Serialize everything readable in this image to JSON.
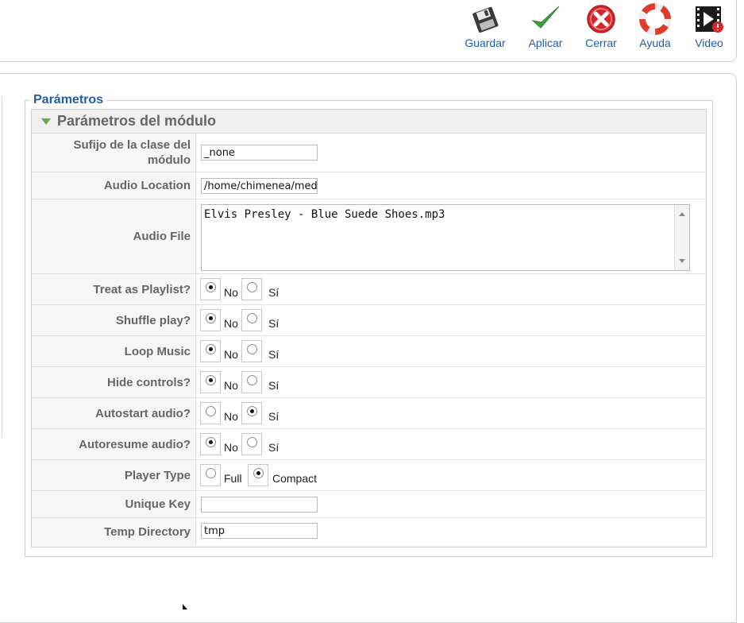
{
  "toolbar": {
    "buttons": [
      {
        "label": "Guardar",
        "icon": "save-icon"
      },
      {
        "label": "Aplicar",
        "icon": "checkmark-icon"
      },
      {
        "label": "Cerrar",
        "icon": "close-icon"
      },
      {
        "label": "Ayuda",
        "icon": "help-lifebuoy-icon"
      },
      {
        "label": "Video",
        "icon": "video-icon"
      }
    ]
  },
  "fieldset": {
    "legend": "Parámetros",
    "pane_title": "Parámetros del módulo"
  },
  "params": {
    "suffix": {
      "label": "Sufijo de la clase del módulo",
      "value": "_none"
    },
    "audio_location": {
      "label": "Audio Location",
      "value": "/home/chimenea/med"
    },
    "audio_file": {
      "label": "Audio File",
      "value": "Elvis Presley - Blue Suede Shoes.mp3"
    },
    "treat_playlist": {
      "label": "Treat as Playlist?",
      "selected": "No"
    },
    "shuffle": {
      "label": "Shuffle play?",
      "selected": "No"
    },
    "loop": {
      "label": "Loop Music",
      "selected": "No"
    },
    "hide_controls": {
      "label": "Hide controls?",
      "selected": "No"
    },
    "autostart": {
      "label": "Autostart audio?",
      "selected": "Sí"
    },
    "autoresume": {
      "label": "Autoresume audio?",
      "selected": "No"
    },
    "player_type": {
      "label": "Player Type",
      "selected": "Compact"
    },
    "unique_key": {
      "label": "Unique Key",
      "value": ""
    },
    "temp_dir": {
      "label": "Temp Directory",
      "value": "tmp"
    }
  },
  "options": {
    "no": "No",
    "si": "Sí",
    "full": "Full",
    "compact": "Compact"
  },
  "colors": {
    "link_blue": "#1f5fa8",
    "label_gray": "#666666",
    "accent_green": "#6aa84f",
    "close_red": "#d9262b"
  }
}
